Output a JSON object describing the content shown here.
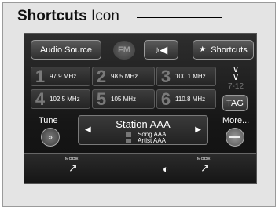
{
  "callout": {
    "bold": "Shortcuts",
    "rest": " Icon"
  },
  "top_bar": {
    "audio_source": "Audio Source",
    "band": "FM",
    "music_glyph": "♪◀",
    "shortcuts_star": "★",
    "shortcuts_label": "Shortcuts"
  },
  "presets": [
    {
      "number": "1",
      "freq": "97.9 MHz"
    },
    {
      "number": "2",
      "freq": "98.5 MHz"
    },
    {
      "number": "3",
      "freq": "100.1 MHz"
    },
    {
      "number": "4",
      "freq": "102.5 MHz"
    },
    {
      "number": "5",
      "freq": "105 MHz"
    },
    {
      "number": "6",
      "freq": "110.8 MHz"
    }
  ],
  "page": {
    "range": "7-12"
  },
  "tag_label": "TAG",
  "tune_label": "Tune",
  "more_label": "More...",
  "station": {
    "name": "Station AAA",
    "song": "Song AAA",
    "artist": "Artist AAA"
  },
  "bottom": {
    "mode_text": "MODE"
  },
  "icons": [
    "chevron-double-down-icon",
    "tune-knob-icon",
    "seat-airflow-icon",
    "rear-defrost-icon",
    "star-icon",
    "music-note-icon"
  ]
}
